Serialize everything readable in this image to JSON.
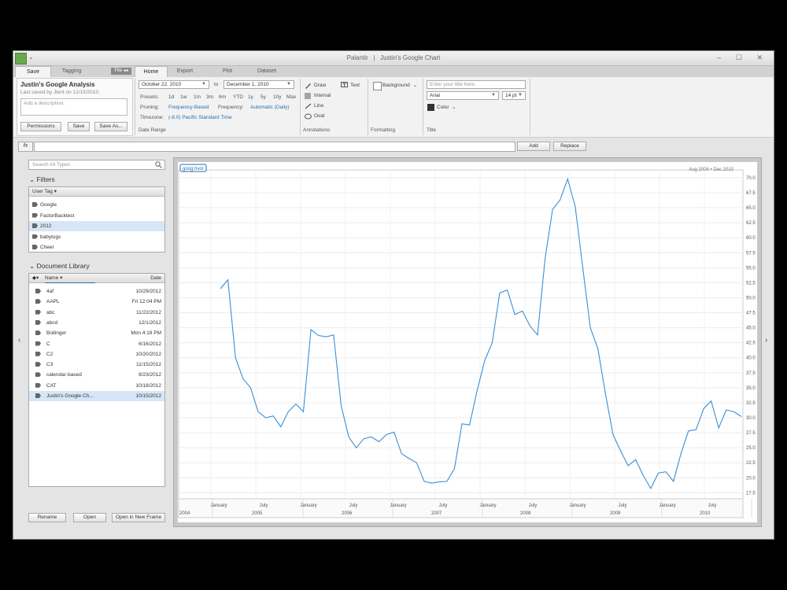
{
  "window": {
    "app_name": "Palantir",
    "separator": "|",
    "title": "Justin's Google Chart",
    "controls": "– ☐ ✕"
  },
  "tabs": {
    "save": "Save",
    "tagging": "Tagging",
    "file_badge": "File ◂◂",
    "home": "Home",
    "export": "Export",
    "plot": "Plot",
    "dataset": "Dataset"
  },
  "save_panel": {
    "title": "Justin's Google Analysis",
    "saved_by": "Last saved by Jlent on 12/15/2010.",
    "description_placeholder": "Add a description.",
    "permissions": "Permissions",
    "save": "Save",
    "save_as": "Save As..."
  },
  "date_range": {
    "from": "October 22, 2010",
    "to_label": "to",
    "to": "December 1, 2010",
    "presets_label": "Presets:",
    "presets": [
      "1d",
      "1w",
      "1m",
      "3m",
      "6m",
      "YTD",
      "1y",
      "5y",
      "10y",
      "Max"
    ],
    "pruning_label": "Pruning:",
    "pruning": "Frequency-Based",
    "frequency_label": "Frequency:",
    "frequency": "Automatic (Daily)",
    "timezone_label": "Timezone:",
    "timezone": "(-8.0) Pacific Standard Time",
    "group_label": "Date Range"
  },
  "annotations": {
    "draw": "Draw",
    "text": "Text",
    "interval": "Interval",
    "line": "Line",
    "oval": "Oval",
    "group_label": "Annotations"
  },
  "formatting": {
    "background": "Background",
    "group_label": "Formatting"
  },
  "title_group": {
    "placeholder": "Enter your title here.",
    "font": "Arial",
    "size": "14 pt",
    "color": "Color",
    "group_label": "Title"
  },
  "formula": {
    "fx": "fx",
    "add": "Add",
    "replace": "Replace"
  },
  "left": {
    "search_placeholder": "Search All Types",
    "filters_title": "Filters",
    "filters_header": "User Tag",
    "filters": [
      "Google",
      "FactorBacktest",
      "2012",
      "babytugs",
      "Cheer"
    ],
    "library_title": "Document Library",
    "library_header_name": "Name",
    "library_header_date": "Date",
    "documents": [
      {
        "name": "4af",
        "date": "10/29/2012"
      },
      {
        "name": "AAPL",
        "date": "Fri 12:04 PM"
      },
      {
        "name": "abc",
        "date": "11/22/2012"
      },
      {
        "name": "abcd",
        "date": "12/1/2012"
      },
      {
        "name": "Bollinger",
        "date": "Mon 4:18 PM"
      },
      {
        "name": "C",
        "date": "6/16/2012"
      },
      {
        "name": "C2",
        "date": "10/20/2012"
      },
      {
        "name": "C3",
        "date": "11/15/2012"
      },
      {
        "name": "calendar-based",
        "date": "8/23/2012"
      },
      {
        "name": "CAT",
        "date": "10/18/2012"
      },
      {
        "name": "Justin's Google Ch...",
        "date": "10/15/2012"
      }
    ],
    "rename": "Rename",
    "open": "Open",
    "open_new": "Open in New Frame"
  },
  "colors": {
    "line": "#3a8fd6",
    "accent": "#2a6db0",
    "selected": "#d6e6f6"
  },
  "chart_data": {
    "type": "line",
    "series": [
      {
        "name": "goog.hvol",
        "values": [
          51.5,
          53,
          40,
          36.5,
          35,
          31,
          30,
          30.3,
          28.5,
          31,
          32.3,
          31,
          44.7,
          43.7,
          43.5,
          43.8,
          32,
          26.8,
          25,
          26.5,
          26.8,
          26,
          27.2,
          27.6,
          24,
          23.2,
          22.5,
          19.4,
          19.1,
          19.3,
          19.4,
          21.5,
          29,
          28.8,
          34.5,
          39.5,
          42.5,
          50.8,
          51.3,
          47.2,
          47.8,
          45.3,
          43.8,
          56.5,
          64.7,
          66.3,
          69.8,
          65.2,
          55,
          45,
          41.5,
          34,
          27.2,
          24.5,
          22,
          23,
          20.4,
          18.2,
          20.8,
          21,
          19.4,
          24,
          27.8,
          28,
          31.5,
          32.8,
          28.3,
          31.3,
          31,
          30.2
        ]
      }
    ],
    "date_range": {
      "start": "Aug 2004",
      "end": "Dec 2010"
    },
    "x_month_labels": [
      "January",
      "July",
      "January",
      "July",
      "January",
      "July",
      "January",
      "July",
      "January",
      "July",
      "January",
      "July"
    ],
    "x_year_labels": [
      "2004",
      "2005",
      "2006",
      "2007",
      "2008",
      "2009",
      "2010"
    ],
    "y_ticks": [
      "70.0",
      "67.5",
      "65.0",
      "62.5",
      "60.0",
      "57.5",
      "55.0",
      "52.5",
      "50.0",
      "47.5",
      "45.0",
      "42.5",
      "40.0",
      "37.5",
      "35.0",
      "32.5",
      "30.0",
      "27.5",
      "25.0",
      "22.5",
      "20.0",
      "17.5"
    ],
    "ylim": [
      16.5,
      71.3
    ],
    "grid": true
  }
}
